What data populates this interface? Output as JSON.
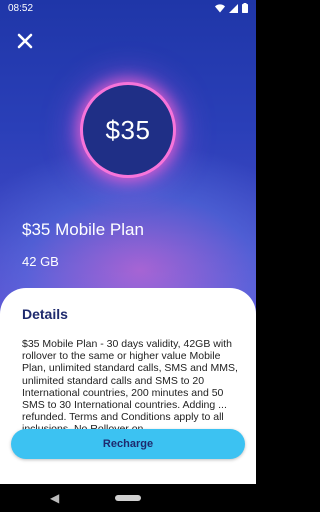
{
  "status_bar": {
    "time": "08:52",
    "icons": [
      "wifi-icon",
      "signal-icon",
      "battery-icon"
    ]
  },
  "header": {
    "close_icon": "close-icon"
  },
  "hero": {
    "price": "$35",
    "plan_title": "$35 Mobile Plan",
    "data_allowance": "42 GB"
  },
  "details": {
    "title": "Details",
    "body": "$35 Mobile Plan - 30 days validity, 42GB with rollover to the same or higher value Mobile Plan, unlimited standard calls, SMS and MMS, unlimited standard calls and SMS to 20 International countries, 200 minutes and 50 SMS to 30 International countries. Adding ... refunded. Terms and Conditions apply to all inclusions. No Rollover on"
  },
  "actions": {
    "recharge_label": "Recharge"
  },
  "navigation": {
    "back_icon": "back-triangle-icon",
    "home_icon": "home-pill-icon"
  },
  "colors": {
    "accent_button": "#3cc2f2",
    "title_dark": "#1e2a6e",
    "glow": "#f078dc",
    "background_top": "#1f36a8"
  }
}
